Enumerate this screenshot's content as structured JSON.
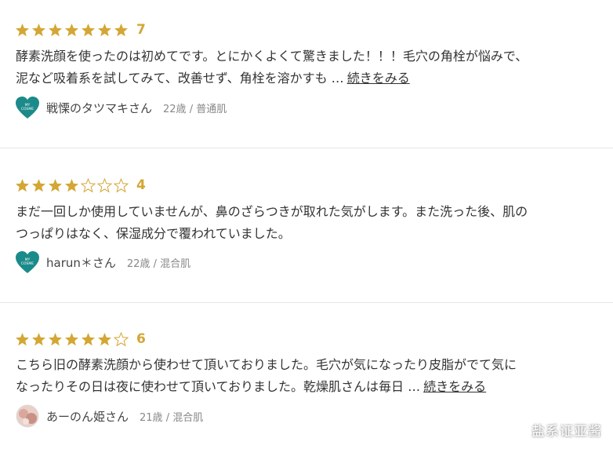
{
  "colors": {
    "star_filled": "#d4a634",
    "star_empty": "#d4a634",
    "avatar_teal": "#1b8a8a"
  },
  "reviews": [
    {
      "rating": 7,
      "max_rating": 7,
      "score_label": "7",
      "text_lines": [
        "酵素洗顔を使ったのは初めてです。とにかくよくて驚きました！！！毛穴の角栓が悩みで、",
        "泥など吸着系を試してみて、改善せず、角栓を溶かすも …"
      ],
      "more_label": "続きをみる",
      "author_name": "戦慄のタツマキさん",
      "author_meta": "22歳 / 普通肌",
      "avatar": "heart-badge-icon"
    },
    {
      "rating": 4,
      "max_rating": 7,
      "score_label": "4",
      "text_lines": [
        "まだ一回しか使用していませんが、鼻のざらつきが取れた気がします。また洗った後、肌の",
        "つっぱりはなく、保湿成分で覆われていました。"
      ],
      "more_label": "",
      "author_name": "harun＊さん",
      "author_meta": "22歳 / 混合肌",
      "avatar": "heart-badge-icon"
    },
    {
      "rating": 6,
      "max_rating": 7,
      "score_label": "6",
      "text_lines": [
        "こちら旧の酵素洗顔から使わせて頂いておりました。毛穴が気になったり皮脂がでて気に",
        "なったりその日は夜に使わせて頂いておりました。乾燥肌さんは毎日 …"
      ],
      "more_label": "続きをみる",
      "author_name": "あーのん姫さん",
      "author_meta": "21歳 / 混合肌",
      "avatar": "photo-avatar"
    }
  ],
  "watermark": "盐系证亚酱"
}
